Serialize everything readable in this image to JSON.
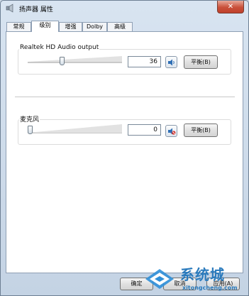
{
  "window": {
    "title": "扬声器 属性",
    "close_glyph": "✕"
  },
  "tabs": [
    {
      "label": "常规"
    },
    {
      "label": "级别"
    },
    {
      "label": "增强"
    },
    {
      "label": "Dolby"
    },
    {
      "label": "高级"
    }
  ],
  "active_tab": "级别",
  "levels": [
    {
      "name": "Realtek HD Audio output",
      "volume": 36,
      "muted": false,
      "balance_label": "平衡(B)"
    },
    {
      "name": "麦克风",
      "volume": 0,
      "muted": true,
      "balance_label": "平衡(B)"
    }
  ],
  "footer": {
    "ok": "确定",
    "cancel": "取消",
    "apply": "应用(A)"
  },
  "watermark": {
    "brand": "系统城",
    "domain": "xitongcheng.com",
    "logo_color": "#2f8fd8"
  },
  "colors": {
    "accent": "#2f8fd8",
    "mute_red": "#d0302a"
  }
}
